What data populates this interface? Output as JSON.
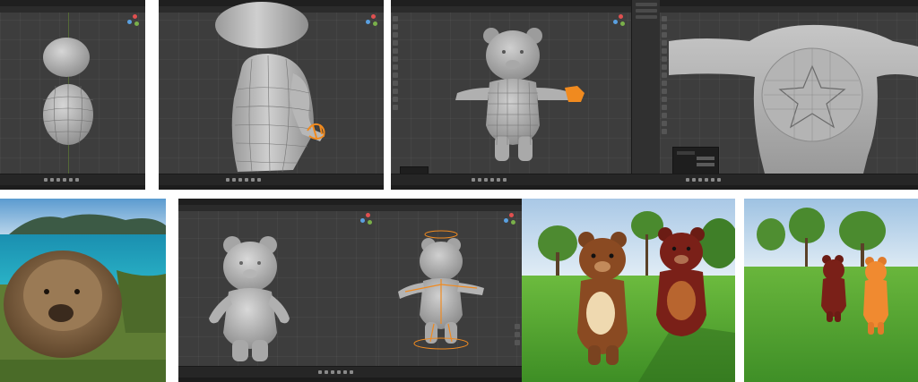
{
  "panels": [
    {
      "id": "head-and-body-blockout"
    },
    {
      "id": "arm-close-up"
    },
    {
      "id": "full-bear-arm-selected"
    },
    {
      "id": "torso-star-detail"
    },
    {
      "id": "wombat-reference-photo"
    },
    {
      "id": "bear-sculpt-front"
    },
    {
      "id": "bear-rigged-t-pose"
    },
    {
      "id": "rendered-fur-bears-close"
    },
    {
      "id": "rendered-fur-bears-far"
    }
  ],
  "colors": {
    "viewport_bg": "#3d3d3d",
    "selection_orange": "#f08a1f",
    "mesh_gray": "#b9b9b9",
    "grass": "#4fa132",
    "sky": "#bcd6ee",
    "fur_brown": "#8a4a22",
    "fur_red": "#7a2018"
  }
}
